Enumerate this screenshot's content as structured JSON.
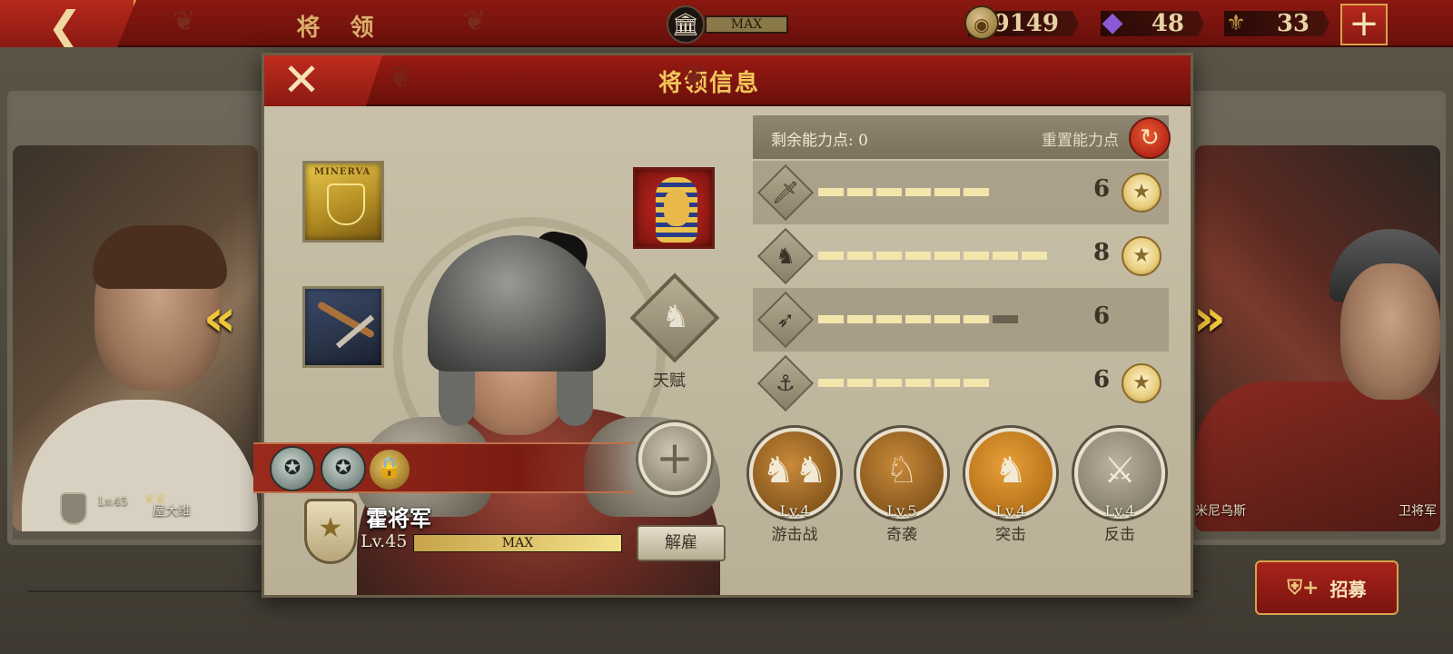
{
  "topbar": {
    "title": "将 领",
    "building_status": "MAX",
    "coins": "39149",
    "gems": "48",
    "tokens": "33",
    "building_icon": "building-icon",
    "coin_icon": "coin-icon",
    "gem_icon": "gem-icon",
    "token_icon": "spqr-icon"
  },
  "background": {
    "left_general": {
      "name": "屋大维",
      "level": "Lv.45"
    },
    "right_general_a": {
      "name": "米尼乌斯"
    },
    "right_general_b": {
      "name": "卫将军"
    }
  },
  "recruit": {
    "label": "招募"
  },
  "modal": {
    "title": "将领信息",
    "talent_label": "天赋",
    "general": {
      "name": "霍将军",
      "level": "Lv.45",
      "exp_text": "MAX",
      "exp_fraction": 1.0,
      "ranks_unlocked": 2
    },
    "item_slots": {
      "banner_text": "MINERVA"
    },
    "dismiss_label": "解雇",
    "stats": {
      "remaining_label": "剩余能力点:",
      "remaining_value": "0",
      "reset_label": "重置能力点",
      "rows": [
        {
          "icon": "sword-icon",
          "value": "6",
          "filled": 6,
          "total": 6,
          "starred": true
        },
        {
          "icon": "horse-icon",
          "value": "8",
          "filled": 8,
          "total": 8,
          "starred": true
        },
        {
          "icon": "bow-icon",
          "value": "6",
          "filled": 6,
          "total": 7,
          "starred": false
        },
        {
          "icon": "anchor-icon",
          "value": "6",
          "filled": 6,
          "total": 6,
          "starred": true
        }
      ]
    },
    "skills": [
      {
        "level": "Lv.4",
        "name": "游击战",
        "style": "bronze"
      },
      {
        "level": "Lv.5",
        "name": "奇袭",
        "style": "bronze"
      },
      {
        "level": "Lv.4",
        "name": "突击",
        "style": "orange"
      },
      {
        "level": "Lv.4",
        "name": "反击",
        "style": "grey"
      }
    ]
  },
  "colors": {
    "primary_red": "#8a1810",
    "gold": "#f2c65a",
    "parchment": "#cbc2ab"
  }
}
